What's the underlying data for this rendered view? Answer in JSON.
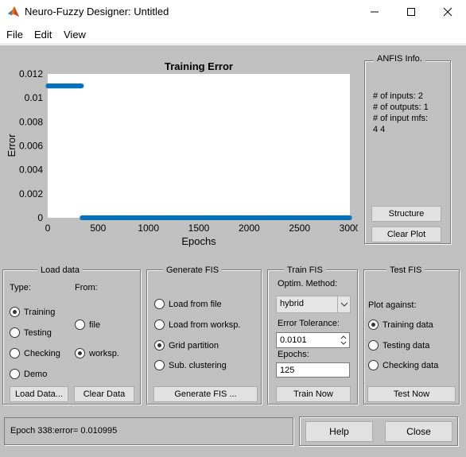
{
  "window": {
    "title": "Neuro-Fuzzy Designer: Untitled",
    "app_icon": "matlab-logo-icon",
    "controls": [
      "minimize-icon",
      "maximize-icon",
      "close-icon"
    ]
  },
  "menu": {
    "items": [
      "File",
      "Edit",
      "View"
    ]
  },
  "plot": {
    "title": "Training Error",
    "xlabel": "Epochs",
    "ylabel": "Error"
  },
  "chart_data": {
    "type": "scatter",
    "title": "Training Error",
    "xlabel": "Epochs",
    "ylabel": "Error",
    "xlim": [
      0,
      3000
    ],
    "ylim": [
      0,
      0.012
    ],
    "xticks": [
      0,
      500,
      1000,
      1500,
      2000,
      2500,
      3000
    ],
    "xtick_labels": [
      "0",
      "500",
      "1000",
      "1500",
      "2000",
      "2500",
      "3000"
    ],
    "yticks": [
      0,
      0.002,
      0.004,
      0.006,
      0.008,
      0.01,
      0.012
    ],
    "ytick_labels": [
      "0",
      "0.002",
      "0.004",
      "0.006",
      "0.008",
      "0.01",
      "0.012"
    ],
    "marker": "*",
    "grid": false,
    "series": [
      {
        "color": "#0072bd",
        "x_range": [
          1,
          338
        ],
        "y": 0.010995
      },
      {
        "color": "#0072bd",
        "x_range": [
          339,
          3000
        ],
        "y": 0
      }
    ]
  },
  "anfis_info": {
    "legend": "ANFIS Info.",
    "lines": [
      "# of inputs: 2",
      "# of outputs: 1",
      "# of input mfs:",
      "4  4"
    ],
    "structure_button": "Structure",
    "clear_plot_button": "Clear Plot"
  },
  "load_data": {
    "legend": "Load data",
    "type_label": "Type:",
    "from_label": "From:",
    "type_options": [
      "Training",
      "Testing",
      "Checking",
      "Demo"
    ],
    "type_selected": "Training",
    "from_options": [
      "file",
      "worksp."
    ],
    "from_selected": "worksp.",
    "load_button": "Load Data...",
    "clear_button": "Clear Data"
  },
  "generate_fis": {
    "legend": "Generate FIS",
    "options": [
      "Load from file",
      "Load from worksp.",
      "Grid partition",
      "Sub. clustering"
    ],
    "selected": "Grid partition",
    "button": "Generate FIS ..."
  },
  "train_fis": {
    "legend": "Train FIS",
    "method_label": "Optim. Method:",
    "method_value": "hybrid",
    "tolerance_label": "Error Tolerance:",
    "tolerance_value": "0.0101",
    "epochs_label": "Epochs:",
    "epochs_value": "125",
    "button": "Train Now"
  },
  "test_fis": {
    "legend": "Test FIS",
    "plot_against_label": "Plot against:",
    "options": [
      "Training data",
      "Testing data",
      "Checking data"
    ],
    "selected": "Training data",
    "button": "Test Now"
  },
  "status": {
    "text": "Epoch 338:error= 0.010995"
  },
  "footer": {
    "help_button": "Help",
    "close_button": "Close"
  }
}
